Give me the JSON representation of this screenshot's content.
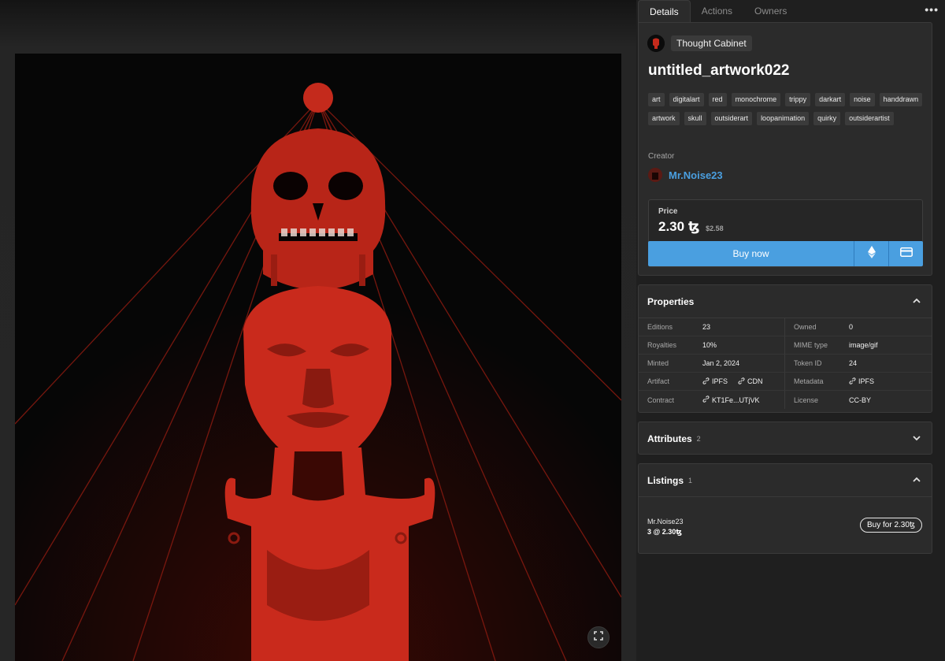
{
  "artwork": {
    "alt": "untitled_artwork022",
    "fullscreen_icon": "expand-icon"
  },
  "tabs": [
    {
      "label": "Details",
      "active": true
    },
    {
      "label": "Actions",
      "active": false
    },
    {
      "label": "Owners",
      "active": false
    }
  ],
  "more_menu_label": "•••",
  "collection": {
    "name": "Thought Cabinet"
  },
  "token": {
    "title": "untitled_artwork022",
    "tags": [
      "art",
      "digitalart",
      "red",
      "monochrome",
      "trippy",
      "darkart",
      "noise",
      "handdrawn",
      "artwork",
      "skull",
      "outsiderart",
      "loopanimation",
      "quirky",
      "outsiderartist"
    ]
  },
  "creator": {
    "label": "Creator",
    "name": "Mr.Noise23"
  },
  "price": {
    "label": "Price",
    "value": "2.30",
    "currency_symbol": "ꜩ",
    "usd": "$2.58",
    "buy_label": "Buy now",
    "eth_icon": "ethereum-icon",
    "card_icon": "credit-card-icon"
  },
  "properties": {
    "title": "Properties",
    "rows": [
      {
        "left_key": "Editions",
        "left_val": "23",
        "right_key": "Owned",
        "right_val": "0"
      },
      {
        "left_key": "Royalties",
        "left_val": "10%",
        "right_key": "MIME type",
        "right_val": "image/gif"
      },
      {
        "left_key": "Minted",
        "left_val": "Jan 2, 2024",
        "right_key": "Token ID",
        "right_val": "24"
      },
      {
        "left_key": "Artifact",
        "left_links": [
          "IPFS",
          "CDN"
        ],
        "right_key": "Metadata",
        "right_links": [
          "IPFS"
        ]
      },
      {
        "left_key": "Contract",
        "left_links": [
          "KT1Fe...UTjVK"
        ],
        "right_key": "License",
        "right_val": "CC-BY"
      }
    ]
  },
  "attributes": {
    "title": "Attributes",
    "count": "2"
  },
  "listings": {
    "title": "Listings",
    "count": "1",
    "items": [
      {
        "seller": "Mr.Noise23",
        "quantity": "3 @ 2.30ꜩ",
        "button": "Buy for 2.30ꜩ"
      }
    ]
  },
  "colors": {
    "background": "#1e1e1e",
    "panel": "#2b2b2b",
    "accent": "#4a9fe0",
    "artwork_red": "#c92a1c"
  }
}
